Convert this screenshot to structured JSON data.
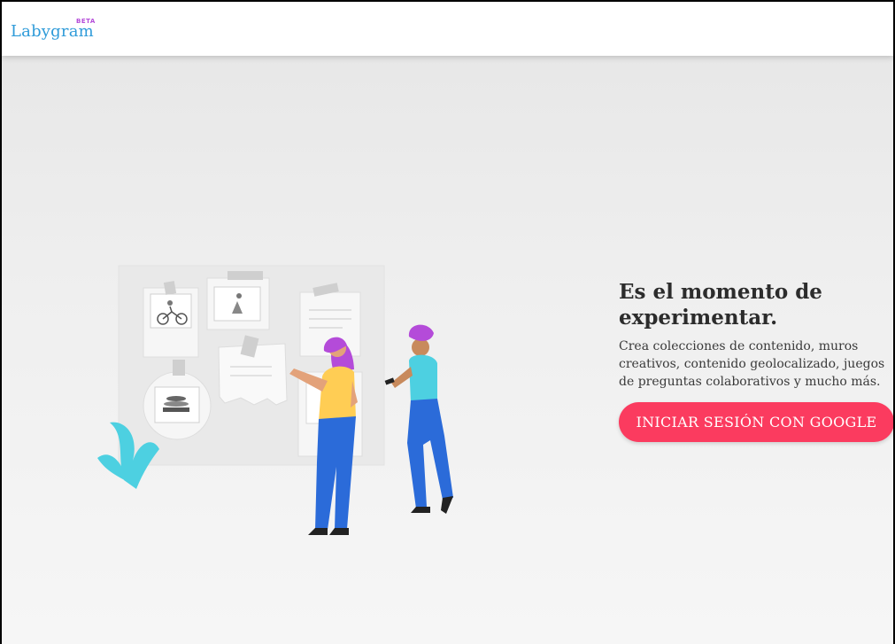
{
  "header": {
    "logo_text": "Labygram",
    "beta_badge": "BETA"
  },
  "hero": {
    "title": "Es el momento de experimentar.",
    "description": "Crea colecciones de contenido, muros creativos, contenido geolocalizado, juegos de preguntas colaborativos y mucho más.",
    "login_button_label": "INICIAR SESIÓN CON GOOGLE"
  },
  "colors": {
    "brand_blue": "#2f9bd9",
    "beta_purple": "#b44bd9",
    "cta_pink": "#fb3b5f"
  },
  "illustration": {
    "name": "people-at-moodboard-illustration"
  }
}
